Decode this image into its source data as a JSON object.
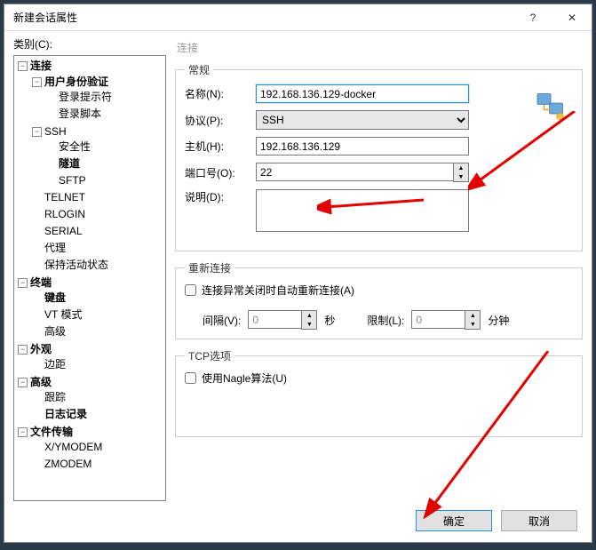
{
  "title": "新建会话属性",
  "help_icon": "?",
  "close_icon": "✕",
  "category_label": "类别(C):",
  "tree": {
    "connection": "连接",
    "user_auth": "用户身份验证",
    "login_prompt": "登录提示符",
    "login_script": "登录脚本",
    "ssh": "SSH",
    "security": "安全性",
    "tunnel": "隧道",
    "sftp": "SFTP",
    "telnet": "TELNET",
    "rlogin": "RLOGIN",
    "serial": "SERIAL",
    "proxy": "代理",
    "keepalive": "保持活动状态",
    "terminal": "终端",
    "keyboard": "键盘",
    "vt": "VT 模式",
    "advanced_term": "高级",
    "appearance": "外观",
    "margin": "边距",
    "advanced": "高级",
    "trace": "跟踪",
    "log": "日志记录",
    "file_transfer": "文件传输",
    "xymodem": "X/YMODEM",
    "zmodem": "ZMODEM"
  },
  "pane_header": "连接",
  "general_legend": "常规",
  "name_label": "名称(N):",
  "name_value": "192.168.136.129-docker",
  "protocol_label": "协议(P):",
  "protocol_value": "SSH",
  "host_label": "主机(H):",
  "host_value": "192.168.136.129",
  "port_label": "端口号(O):",
  "port_value": "22",
  "desc_label": "说明(D):",
  "desc_value": "",
  "reconnect_legend": "重新连接",
  "reconnect_chk": "连接异常关闭时自动重新连接(A)",
  "interval_label": "间隔(V):",
  "interval_value": "0",
  "seconds": "秒",
  "limit_label": "限制(L):",
  "limit_value": "0",
  "minutes": "分钟",
  "tcp_legend": "TCP选项",
  "nagle_chk": "使用Nagle算法(U)",
  "ok": "确定",
  "cancel": "取消"
}
